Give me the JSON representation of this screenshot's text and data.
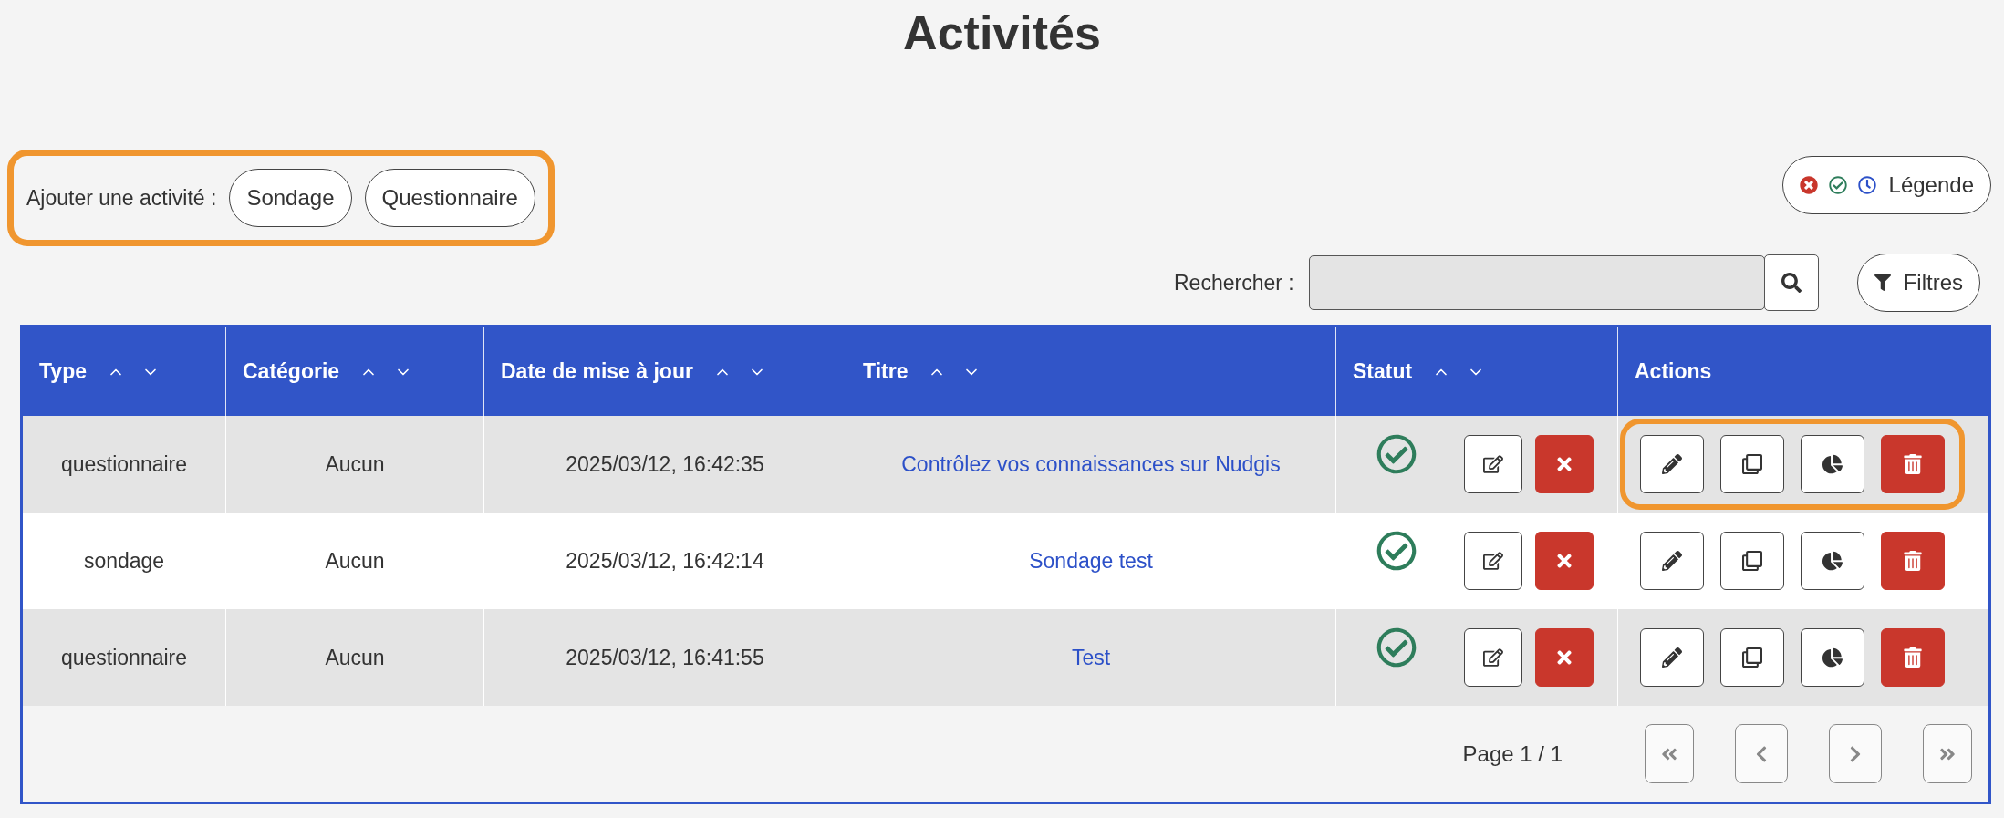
{
  "title": "Activités",
  "add_activity": {
    "label": "Ajouter une activité :",
    "highlighted": true,
    "buttons": [
      "Sondage",
      "Questionnaire"
    ]
  },
  "legend_button": {
    "label": "Légende"
  },
  "search": {
    "label": "Rechercher :"
  },
  "filters_button": {
    "label": "Filtres"
  },
  "table": {
    "columns": [
      {
        "label": "Type",
        "sortable": true
      },
      {
        "label": "Catégorie",
        "sortable": true
      },
      {
        "label": "Date de mise à jour",
        "sortable": true
      },
      {
        "label": "Titre",
        "sortable": true
      },
      {
        "label": "Statut",
        "sortable": true
      },
      {
        "label": "Actions",
        "sortable": false
      }
    ],
    "rows": [
      {
        "type": "questionnaire",
        "category": "Aucun",
        "date": "2025/03/12, 16:42:35",
        "title": "Contrôlez vos connaissances sur Nudgis",
        "approved": true,
        "actions_highlighted": true
      },
      {
        "type": "sondage",
        "category": "Aucun",
        "date": "2025/03/12, 16:42:14",
        "title": "Sondage test",
        "approved": true,
        "actions_highlighted": false
      },
      {
        "type": "questionnaire",
        "category": "Aucun",
        "date": "2025/03/12, 16:41:55",
        "title": "Test",
        "approved": true,
        "actions_highlighted": false
      }
    ]
  },
  "pagination": {
    "label": "Page 1 / 1",
    "disabled": true
  }
}
